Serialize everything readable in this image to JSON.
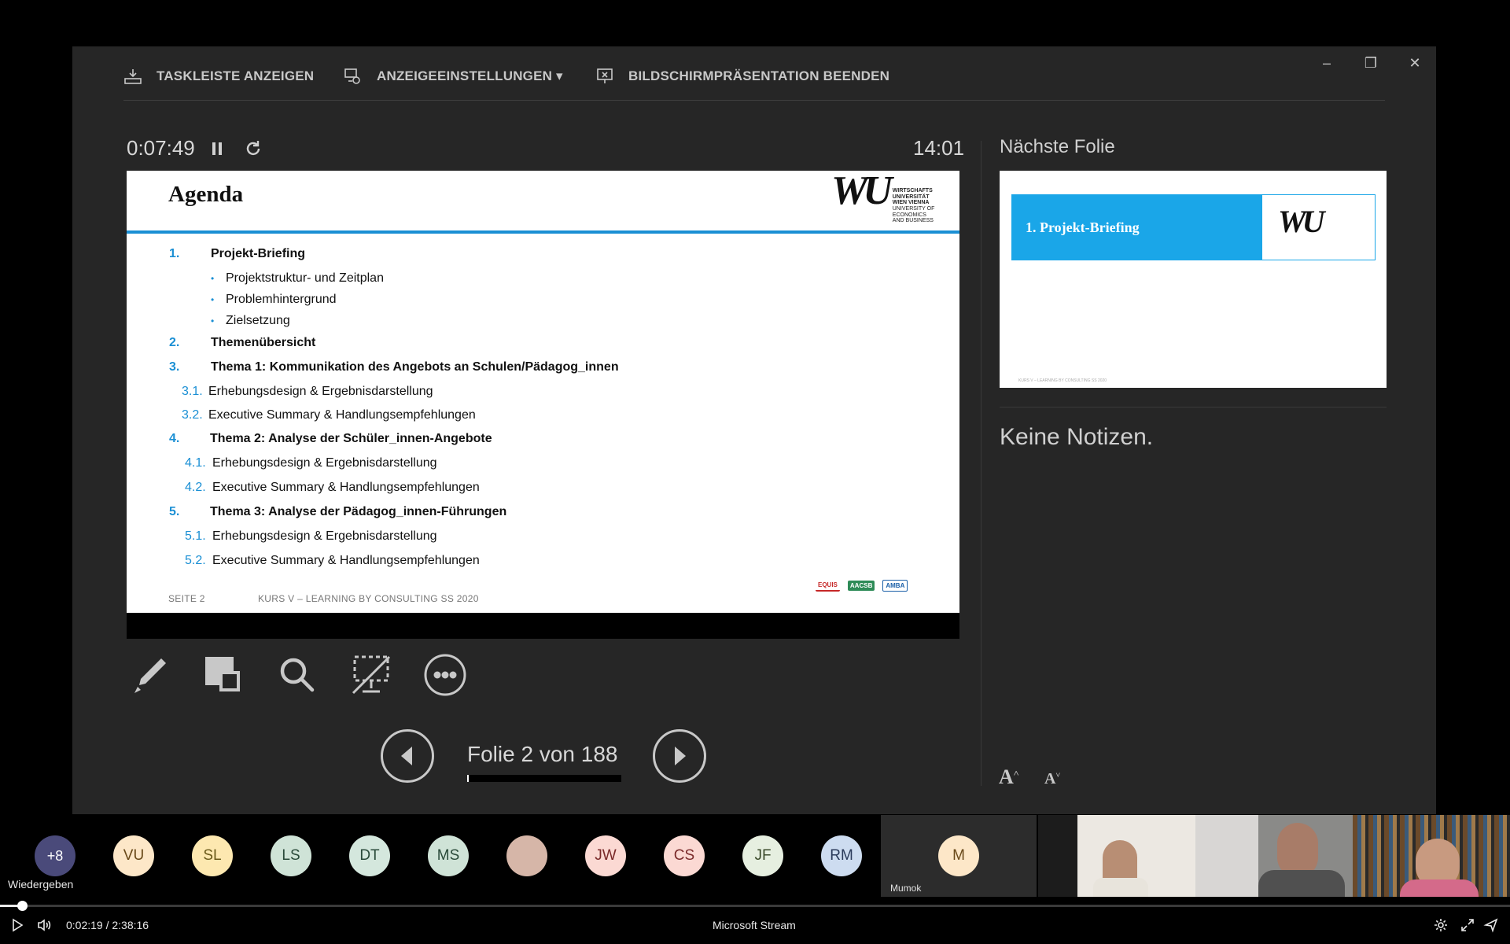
{
  "topbar": {
    "taskbar_label": "TASKLEISTE ANZEIGEN",
    "display_label": "ANZEIGEEINSTELLUNGEN ▾",
    "end_label": "BILDSCHIRMPRÄSENTATION BEENDEN"
  },
  "window_controls": {
    "minimize": "–",
    "restore": "❐",
    "close": "✕"
  },
  "presenter": {
    "elapsed": "0:07:49",
    "clock": "14:01",
    "slide_counter": "Folie 2 von 188",
    "slide_progress": 0.0106
  },
  "slide": {
    "title": "Agenda",
    "logo_mark": "WU",
    "logo_text": [
      "WIRTSCHAFTS",
      "UNIVERSITÄT",
      "WIEN VIENNA",
      "UNIVERSITY OF",
      "ECONOMICS",
      "AND BUSINESS"
    ],
    "items": [
      {
        "num": "1.",
        "text": "Projekt-Briefing"
      },
      {
        "bullet": "•",
        "text": "Projektstruktur- und Zeitplan"
      },
      {
        "bullet": "•",
        "text": "Problemhintergrund"
      },
      {
        "bullet": "•",
        "text": "Zielsetzung"
      },
      {
        "num": "2.",
        "text": "Themenübersicht"
      },
      {
        "num": "3.",
        "text": "Thema 1: Kommunikation des Angebots an Schulen/Pädagog_innen"
      },
      {
        "num": "3.1.",
        "text": "Erhebungsdesign & Ergebnisdarstellung"
      },
      {
        "num": "3.2.",
        "text": "Executive Summary & Handlungsempfehlungen"
      },
      {
        "num": "4.",
        "text": "Thema 2: Analyse der Schüler_innen-Angebote"
      },
      {
        "num": "4.1.",
        "text": "Erhebungsdesign & Ergebnisdarstellung"
      },
      {
        "num": "4.2.",
        "text": "Executive Summary & Handlungsempfehlungen"
      },
      {
        "num": "5.",
        "text": "Thema 3: Analyse der Pädagog_innen-Führungen"
      },
      {
        "num": "5.1.",
        "text": "Erhebungsdesign & Ergebnisdarstellung"
      },
      {
        "num": "5.2.",
        "text": "Executive Summary & Handlungsempfehlungen"
      }
    ],
    "footer_page": "SEITE 2",
    "footer_course": "KURS V – LEARNING BY CONSULTING SS 2020",
    "accreditations": [
      "EQUIS",
      "AACSB",
      "AMBA"
    ]
  },
  "next": {
    "label": "Nächste Folie",
    "banner": "1.  Projekt-Briefing",
    "logo_mark": "WU"
  },
  "notes": {
    "text": "Keine Notizen."
  },
  "participants": {
    "avatars": [
      {
        "initials": "+8",
        "color": "#4a4a7a",
        "text_color": "#ffffff"
      },
      {
        "initials": "VU",
        "color": "#fde7c8",
        "text_color": "#6a4a1a"
      },
      {
        "initials": "SL",
        "color": "#fde8b0",
        "text_color": "#6a5a1a"
      },
      {
        "initials": "LS",
        "color": "#cfe3d7",
        "text_color": "#2a4a3a"
      },
      {
        "initials": "DT",
        "color": "#d4e7dd",
        "text_color": "#2a4a3a"
      },
      {
        "initials": "MS",
        "color": "#cfe3d7",
        "text_color": "#2a4a3a"
      },
      {
        "initials": "",
        "color": "#d6b6a8",
        "text_color": "#333333"
      },
      {
        "initials": "JW",
        "color": "#fbd9d3",
        "text_color": "#7a2a2a"
      },
      {
        "initials": "CS",
        "color": "#fbd9d3",
        "text_color": "#7a2a2a"
      },
      {
        "initials": "JF",
        "color": "#e6efe0",
        "text_color": "#3a4a2a"
      },
      {
        "initials": "RM",
        "color": "#cddcf0",
        "text_color": "#2a3a5a"
      }
    ],
    "mumok": {
      "initials": "M",
      "name": "Mumok",
      "color": "#fde7c8"
    },
    "tooltip": "Wiedergeben"
  },
  "player": {
    "time": "0:02:19  /  2:38:16",
    "title": "Microsoft Stream",
    "progress": 0.0146
  },
  "colors": {
    "accent": "#1a8fd4",
    "banner": "#1aa6e8"
  }
}
